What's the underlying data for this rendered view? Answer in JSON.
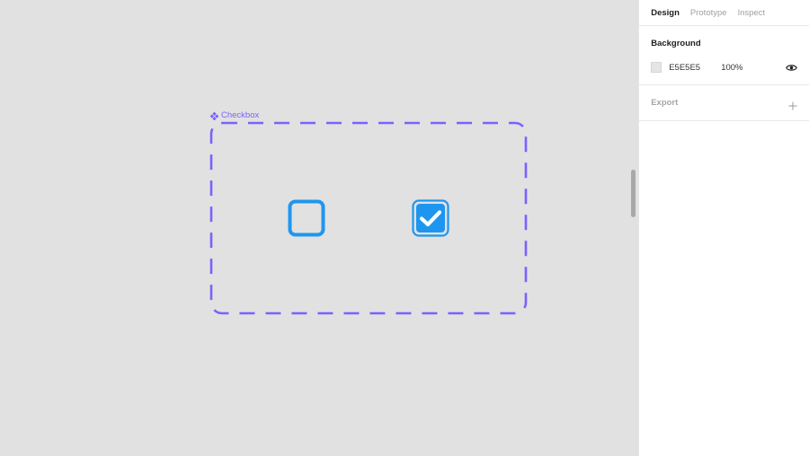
{
  "canvas": {
    "background": "#E1E1E1",
    "component": {
      "label": "Checkbox",
      "icon": "component-icon",
      "accent": "#7B61FF"
    },
    "checkboxes": [
      {
        "state": "unchecked",
        "color": "#1E96F0"
      },
      {
        "state": "checked",
        "color": "#1E96F0",
        "icon": "checkmark-icon"
      }
    ]
  },
  "panel": {
    "tabs": [
      {
        "label": "Design",
        "active": true
      },
      {
        "label": "Prototype",
        "active": false
      },
      {
        "label": "Inspect",
        "active": false
      }
    ],
    "background": {
      "title": "Background",
      "hex": "E5E5E5",
      "opacity": "100%",
      "visibility_icon": "eye-icon"
    },
    "export": {
      "title": "Export",
      "add_icon": "plus-icon"
    }
  }
}
